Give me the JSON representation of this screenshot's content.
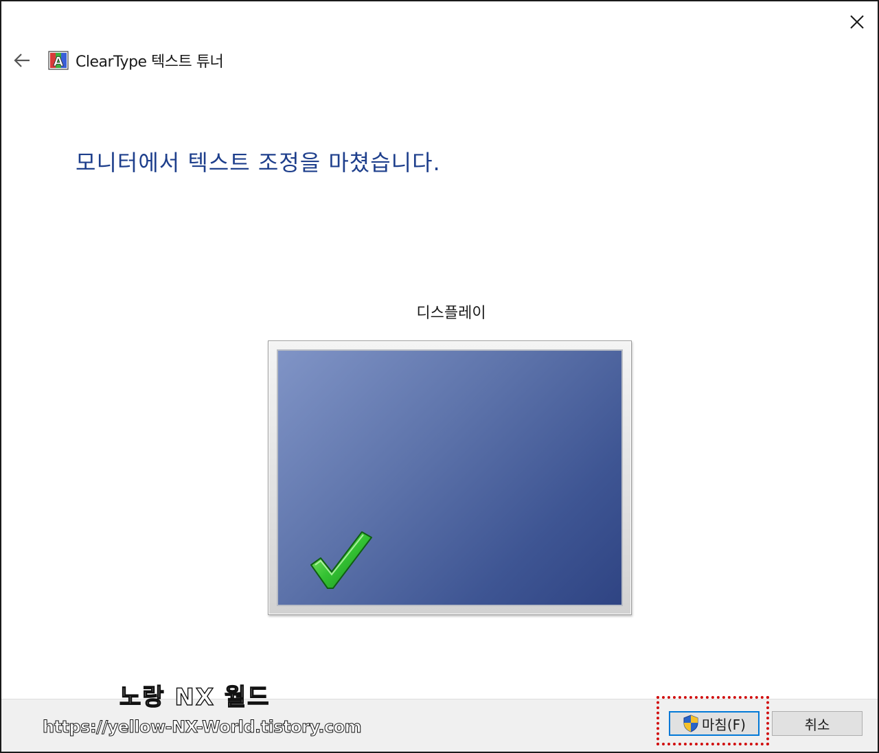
{
  "window": {
    "title": "ClearType 텍스트 튜너",
    "close_icon": "close-icon",
    "back_icon": "back-arrow-icon",
    "app_icon": "cleartype-icon"
  },
  "main": {
    "headline": "모니터에서 텍스트 조정을 마쳤습니다.",
    "display_label": "디스플레이",
    "monitor_icon": "monitor-icon",
    "check_icon": "checkmark-icon"
  },
  "footer": {
    "finish_label": "마침(F)",
    "finish_icon": "uac-shield-icon",
    "cancel_label": "취소"
  },
  "watermark": {
    "title": "노랑 NX 월드",
    "url": "https://yellow-NX-World.tistory.com"
  },
  "colors": {
    "headline": "#1e3f8c",
    "screen_light": "#8094c6",
    "screen_dark": "#2f4483",
    "check_green": "#2fb52f",
    "highlight_red": "#d10f0f",
    "focus_blue": "#0078d7"
  }
}
